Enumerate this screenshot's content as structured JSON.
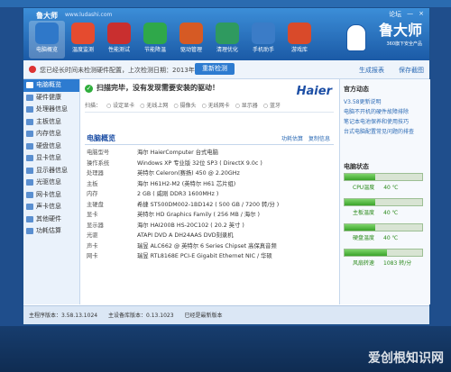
{
  "window": {
    "title": "鲁大师",
    "url": "www.ludashi.com",
    "controls": [
      "论坛",
      "—",
      "×"
    ]
  },
  "toolbar": {
    "items": [
      {
        "label": "电脑概览",
        "color": "#2f78c9"
      },
      {
        "label": "温度监测",
        "color": "#e54b2f"
      },
      {
        "label": "性能测试",
        "color": "#c92f2f"
      },
      {
        "label": "节能降温",
        "color": "#2fa84a"
      },
      {
        "label": "驱动管理",
        "color": "#d65a24"
      },
      {
        "label": "清理优化",
        "color": "#2f9a5f"
      },
      {
        "label": "手机助手",
        "color": "#3b7cc7"
      },
      {
        "label": "游戏库",
        "color": "#d94a2a"
      }
    ],
    "brand": "鲁大师",
    "brand_sub": "360旗下安全产品"
  },
  "notice": {
    "text": "您已经长时间未检测硬件配置，上次检测日期：2013年7月10日",
    "button": "重新检测",
    "right_links": [
      "生成报表",
      "保存截图"
    ]
  },
  "sidebar": {
    "items": [
      "电脑概览",
      "硬件健康",
      "处理器信息",
      "主板信息",
      "内存信息",
      "硬盘信息",
      "显卡信息",
      "显示器信息",
      "光驱信息",
      "网卡信息",
      "声卡信息",
      "其他硬件",
      "功耗估算"
    ]
  },
  "main": {
    "scan_title": "扫描完毕，没有发现需要安装的驱动！",
    "haier": "Haier",
    "steps": [
      "扫描：",
      "○ 设定显卡",
      "○ 无线上网",
      "○ 摄像头",
      "○ 无线网卡",
      "○ 显示器",
      "○ 蓝牙"
    ],
    "overview_title": "电脑概览",
    "overview_links": [
      "功耗估算",
      "复制信息"
    ],
    "rows": [
      {
        "k": "电脑型号",
        "v": "海尔 HaierComputer 台式电脑"
      },
      {
        "k": "操作系统",
        "v": "Windows XP 专业版 32位 SP3 ( DirectX 9.0c )"
      },
      {
        "k": "处理器",
        "v": "英特尔 Celeron(赛扬) 450 @ 2.20GHz"
      },
      {
        "k": "主板",
        "v": "海尔 H61H2-M2 (英特尔 H61 芯片组)"
      },
      {
        "k": "内存",
        "v": "2 GB ( 威刚 DDR3 1600MHz )"
      },
      {
        "k": "主硬盘",
        "v": "希捷 ST500DM002-1BD142 ( 500 GB / 7200 转/分 )"
      },
      {
        "k": "显卡",
        "v": "英特尔 HD Graphics Family ( 256 MB / 海尔 )"
      },
      {
        "k": "显示器",
        "v": "海尔 HAI200B HS-20C102 ( 20.2 英寸 )"
      },
      {
        "k": "光驱",
        "v": "ATAPI DVD A DH24AAS DVD刻录机"
      },
      {
        "k": "声卡",
        "v": "瑞昱 ALC662 @ 英特尔 6 Series Chipset 高保真音频"
      },
      {
        "k": "网卡",
        "v": "瑞昱 RTL8168E PCI-E Gigabit Ethernet NIC / 华硕"
      }
    ]
  },
  "right": {
    "official_title": "官方动态",
    "official_links": [
      "V3.58更新说明",
      "电脑不开机的硬件故障排除",
      "笔记本电池保养和使用技巧",
      "台式电脑配置常见问题的排查"
    ],
    "state_title": "电脑状态",
    "meters": [
      {
        "label": "CPU温度",
        "value": "40 ℃",
        "level": 0.4
      },
      {
        "label": "主板温度",
        "value": "40 ℃",
        "level": 0.4
      },
      {
        "label": "硬盘温度",
        "value": "40 ℃",
        "level": 0.4
      },
      {
        "label": "风扇转速",
        "value": "1083 转/分",
        "level": 0.55
      }
    ]
  },
  "status": {
    "items": [
      "主程序版本：3.58.13.1024",
      "主设备库版本：0.13.1023",
      "已经是最新版本"
    ]
  },
  "watermark": "爱创根知识网"
}
